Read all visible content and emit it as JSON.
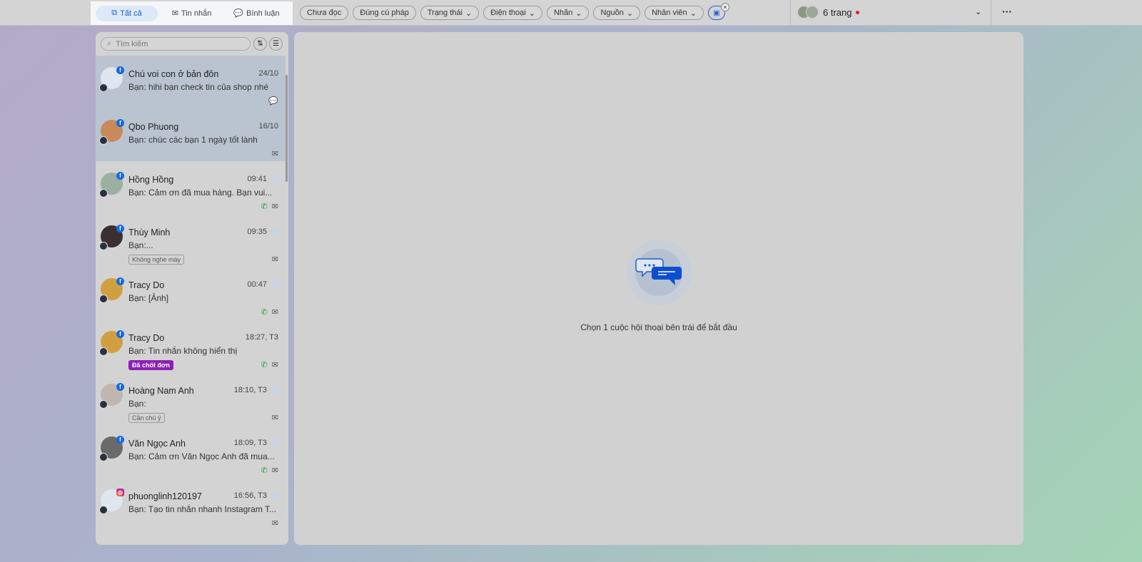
{
  "tabs": [
    {
      "label": "Tất cả",
      "icon": "copy-icon"
    },
    {
      "label": "Tin nhắn",
      "icon": "mail-icon"
    },
    {
      "label": "Bình luận",
      "icon": "comment-icon"
    }
  ],
  "filters": [
    "Chưa đọc",
    "Đúng cú pháp",
    "Trạng thái",
    "Điện thoại",
    "Nhãn",
    "Nguồn",
    "Nhân viên"
  ],
  "filter_dropdowns": [
    false,
    false,
    true,
    true,
    true,
    true,
    true
  ],
  "account": {
    "label": "6 trang"
  },
  "search": {
    "placeholder": "Tìm kiếm"
  },
  "conversations": [
    {
      "name": "Chú voi con ở bản đôn",
      "time": "24/10",
      "preview": "Bạn: hihi bạn check tin của shop nhé",
      "platform": "facebook",
      "selected": true,
      "icons": [
        "comment"
      ],
      "avatar": "#dfe6ef"
    },
    {
      "name": "Qbo Phuong",
      "time": "16/10",
      "preview": "Bạn: chúc các bạn 1 ngày tốt lành",
      "platform": "facebook",
      "selected": true,
      "icons": [
        "mail"
      ],
      "avatar": "#c88a5a"
    },
    {
      "name": "Hồng Hồng",
      "time": "09:41",
      "preview": "Bạn: Cảm ơn đã mua hàng. Bạn vui...",
      "platform": "facebook",
      "indicator": true,
      "icons": [
        "phone",
        "mail"
      ],
      "avatar": "#9bb0a0"
    },
    {
      "name": "Thùy Minh",
      "time": "09:35",
      "preview": "Bạn:...",
      "platform": "facebook",
      "indicator": true,
      "tag": "Không nghe máy",
      "icons": [
        "mail"
      ],
      "avatar": "#3a3030"
    },
    {
      "name": "Tracy Do",
      "time": "00:47",
      "preview": "Bạn: [Ảnh]",
      "platform": "facebook",
      "indicator": true,
      "icons": [
        "phone",
        "mail"
      ],
      "avatar": "#d0a040"
    },
    {
      "name": "Tracy Do",
      "time": "18:27, T3",
      "preview": "Bạn: Tin nhắn không hiển thị",
      "platform": "facebook",
      "tag": "Đã chốt đơn",
      "tag_style": "purple",
      "icons": [
        "phone",
        "mail"
      ],
      "avatar": "#d0a040"
    },
    {
      "name": "Hoàng Nam Anh",
      "time": "18:10, T3",
      "preview": "Bạn:",
      "platform": "facebook",
      "indicator": true,
      "tag": "Cần chú ý",
      "icons": [
        "mail"
      ],
      "avatar": "#c0b8b0"
    },
    {
      "name": "Văn Ngọc Anh",
      "time": "18:09, T3",
      "preview": "Bạn: Cảm ơn Văn Ngọc Anh đã mua...",
      "platform": "facebook",
      "indicator": true,
      "icons": [
        "phone",
        "mail"
      ],
      "avatar": "#6a6a6a"
    },
    {
      "name": "phuonglinh120197",
      "time": "16:56, T3",
      "preview": "Bạn: Tạo tin nhắn nhanh Instagram T...",
      "platform": "instagram",
      "indicator": true,
      "icons": [
        "mail"
      ],
      "avatar": "#dfe6ef"
    }
  ],
  "empty_state": {
    "text": "Chọn 1 cuộc hội thoại bên trái để bắt đầu"
  },
  "colors": {
    "accent": "#1a5fd0",
    "purple_tag": "#8c1fb5",
    "selected": "#b9c4d0"
  }
}
